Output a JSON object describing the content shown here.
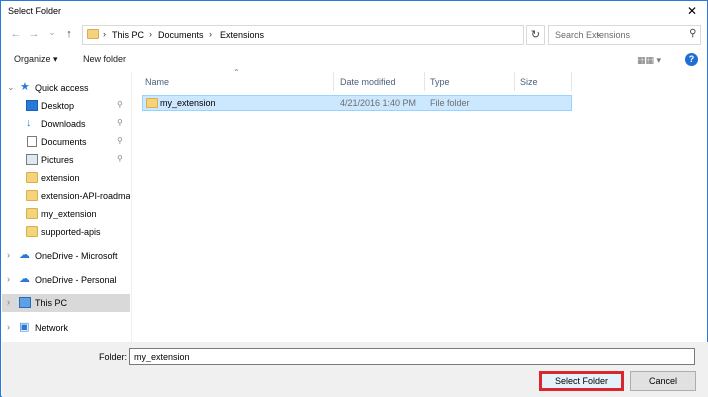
{
  "window": {
    "title": "Select Folder",
    "close": "✕"
  },
  "nav": {
    "back": "←",
    "forward": "→",
    "recent": "⌄",
    "up": "↑",
    "breadcrumbs": [
      "This PC",
      "Documents",
      "Extensions"
    ],
    "separator": "›",
    "refresh": "↻",
    "search_placeholder": "Search Extensions"
  },
  "toolbar": {
    "organize": "Organize ▾",
    "new_folder": "New folder",
    "help": "?"
  },
  "sidebar": {
    "items": [
      {
        "label": "Quick access",
        "icon": "star-icon",
        "chevron": "⌄",
        "pinned": false
      },
      {
        "label": "Desktop",
        "icon": "desktop-icon",
        "pinned": true
      },
      {
        "label": "Downloads",
        "icon": "download-icon",
        "pinned": true
      },
      {
        "label": "Documents",
        "icon": "document-icon",
        "pinned": true
      },
      {
        "label": "Pictures",
        "icon": "pictures-icon",
        "pinned": true
      },
      {
        "label": "extension",
        "icon": "folder-icon",
        "pinned": false
      },
      {
        "label": "extension-API-roadma",
        "icon": "folder-icon",
        "pinned": false
      },
      {
        "label": "my_extension",
        "icon": "folder-icon",
        "pinned": false
      },
      {
        "label": "supported-apis",
        "icon": "folder-icon",
        "pinned": false
      },
      {
        "label": "OneDrive - Microsoft",
        "icon": "onedrive-icon",
        "chevron": "›"
      },
      {
        "label": "OneDrive - Personal",
        "icon": "onedrive-icon",
        "chevron": "›"
      },
      {
        "label": "This PC",
        "icon": "computer-icon",
        "chevron": "›",
        "selected": true
      },
      {
        "label": "Network",
        "icon": "network-icon",
        "chevron": "›"
      }
    ]
  },
  "columns": {
    "name": "Name",
    "date": "Date modified",
    "type": "Type",
    "size": "Size"
  },
  "files": [
    {
      "name": "my_extension",
      "date": "4/21/2016 1:40 PM",
      "type": "File folder",
      "size": ""
    }
  ],
  "bottom": {
    "folder_label": "Folder:",
    "folder_value": "my_extension",
    "select_button": "Select Folder",
    "cancel_button": "Cancel"
  },
  "colors": {
    "accent": "#2b79d6",
    "selection": "#cce8ff",
    "highlight_border": "#d9272e"
  }
}
